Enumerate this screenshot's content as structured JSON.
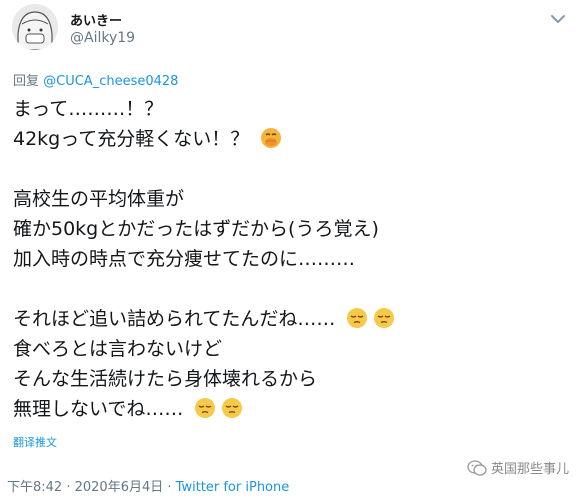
{
  "user": {
    "name": "あいきー",
    "handle": "@Ailky19"
  },
  "reply": {
    "prefix": "回复 ",
    "mention": "@CUCA_cheese0428"
  },
  "tweet": {
    "lines": [
      "まって………！？",
      "42kgって充分軽くない！？",
      "",
      "高校生の平均体重が",
      "確か50kgとかだったはずだから(うろ覚え)",
      "加入時の時点で充分痩せてたのに………",
      "",
      "それほど追い詰められてたんだね……",
      "食べろとは言わないけど",
      "そんな生活続けたら身体壊れるから",
      "無理しないでね……"
    ]
  },
  "translate_label": "翻译推文",
  "meta": {
    "time": "下午8:42",
    "separator": " · ",
    "date": "2020年6月4日",
    "separator2": " · ",
    "source": "Twitter for iPhone"
  },
  "watermark": {
    "text": "英国那些事儿"
  },
  "icons": {
    "emoji_1": "face-with-hand-over-mouth",
    "emoji_2": "pensive-face",
    "chevron": "chevron-down-icon"
  },
  "colors": {
    "link": "#1b95e0",
    "secondary": "#657786",
    "text": "#14171a"
  }
}
